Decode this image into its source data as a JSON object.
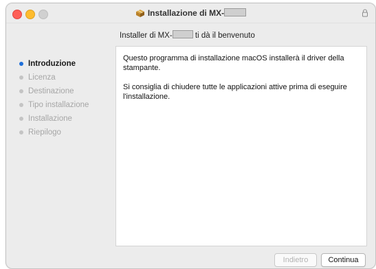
{
  "window": {
    "title_prefix": "Installazione di MX-",
    "title_suffix": ""
  },
  "header": {
    "text_prefix": "Installer di MX-",
    "text_suffix": " ti dà il benvenuto"
  },
  "sidebar": {
    "steps": [
      {
        "label": "Introduzione",
        "active": true
      },
      {
        "label": "Licenza",
        "active": false
      },
      {
        "label": "Destinazione",
        "active": false
      },
      {
        "label": "Tipo installazione",
        "active": false
      },
      {
        "label": "Installazione",
        "active": false
      },
      {
        "label": "Riepilogo",
        "active": false
      }
    ]
  },
  "content": {
    "paragraph1": "Questo programma di installazione macOS installerà il driver della stampante.",
    "paragraph2": "Si consiglia di chiudere tutte le applicazioni attive prima di eseguire l'installazione."
  },
  "buttons": {
    "back_label": "Indietro",
    "continue_label": "Continua"
  },
  "icons": {
    "window_icon": "installer-package-icon",
    "lock_icon": "lock-icon"
  },
  "colors": {
    "active_step_dot": "#1e6fd9",
    "close": "#fe5f57",
    "minimize": "#febc2e"
  }
}
